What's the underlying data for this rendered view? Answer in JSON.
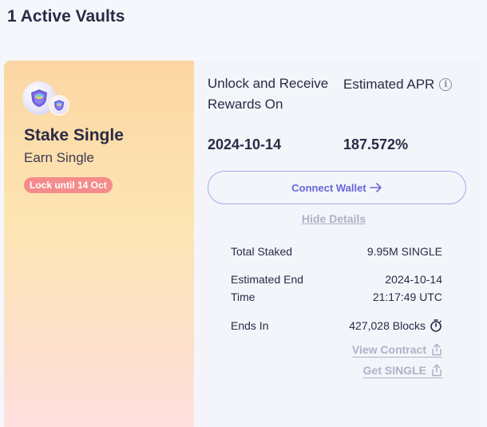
{
  "page": {
    "title": "1 Active Vaults"
  },
  "vault": {
    "name": "Stake Single",
    "earn": "Earn Single",
    "lock_badge": "Lock until 14 Oct",
    "unlock_label": "Unlock and Receive Rewards On",
    "unlock_date": "2024-10-14",
    "apr_label": "Estimated APR",
    "apr_value": "187.572%",
    "connect_label": "Connect Wallet",
    "hide_details_label": "Hide Details",
    "details": {
      "total_staked_label": "Total Staked",
      "total_staked_value": "9.95M SINGLE",
      "estimated_end_label": "Estimated End Time",
      "estimated_end_date": "2024-10-14",
      "estimated_end_time": "21:17:49 UTC",
      "ends_in_label": "Ends In",
      "ends_in_value": "427,028 Blocks"
    },
    "view_contract_label": "View Contract",
    "get_single_label": "Get SINGLE"
  },
  "icons": {
    "info": "info-icon",
    "arrow": "arrow-right-icon",
    "stopwatch": "stopwatch-icon",
    "share": "share-icon",
    "token": "single-token-icon"
  },
  "colors": {
    "accent": "#6667d6",
    "badge": "#f58b8b",
    "muted_link": "#b1b0c7",
    "text": "#2b2a45"
  }
}
